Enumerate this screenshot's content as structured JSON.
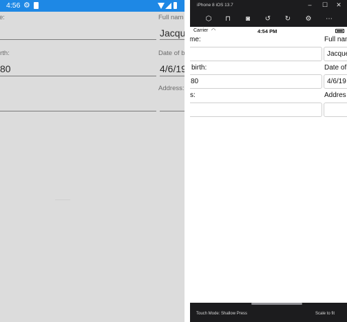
{
  "android": {
    "status_time": "4:56",
    "status_bar_color": "#1e88e5",
    "status_icons": [
      "gear-icon",
      "sim-icon",
      "wifi-icon",
      "signal-icon",
      "battery-icon"
    ],
    "left_column": {
      "name_label": "e:",
      "birth_label": "irth:",
      "birth_value": "80"
    },
    "right_column": {
      "name_label": "Full nam",
      "name_value": "Jacque",
      "birth_label": "Date of bi",
      "birth_value": "4/6/19",
      "address_label": "Address:"
    }
  },
  "ios": {
    "window_title": "iPhone 8 iOS 13.7",
    "toolbar_icons": [
      "home-icon",
      "lock-icon",
      "screenshot-icon",
      "rotate-left-icon",
      "rotate-right-icon",
      "settings-icon",
      "more-icon"
    ],
    "status": {
      "carrier": "Carrier",
      "time": "4:54 PM"
    },
    "left_column": {
      "name_label": "me:",
      "name_value": "",
      "birth_label": "birth:",
      "birth_value": "80",
      "address_label": "s:",
      "address_value": ""
    },
    "right_column": {
      "name_label": "Full nam",
      "name_value": "Jacque",
      "birth_label": "Date of",
      "birth_value": "4/6/19",
      "address_label": "Addres",
      "address_value": ""
    },
    "footer": {
      "touch_mode": "Touch Mode: Shallow Press",
      "scale": "Scale to fit"
    }
  }
}
